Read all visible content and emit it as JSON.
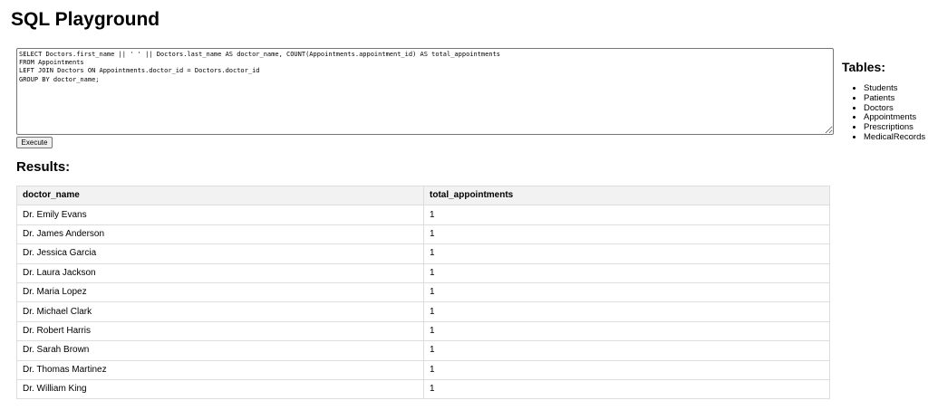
{
  "page": {
    "title": "SQL Playground"
  },
  "editor": {
    "query": "SELECT Doctors.first_name || ' ' || Doctors.last_name AS doctor_name, COUNT(Appointments.appointment_id) AS total_appointments\nFROM Appointments\nLEFT JOIN Doctors ON Appointments.doctor_id = Doctors.doctor_id\nGROUP BY doctor_name;"
  },
  "toolbar": {
    "execute_label": "Execute"
  },
  "results": {
    "heading": "Results:",
    "columns": [
      "doctor_name",
      "total_appointments"
    ],
    "rows": [
      [
        "Dr. Emily Evans",
        "1"
      ],
      [
        "Dr. James Anderson",
        "1"
      ],
      [
        "Dr. Jessica Garcia",
        "1"
      ],
      [
        "Dr. Laura Jackson",
        "1"
      ],
      [
        "Dr. Maria Lopez",
        "1"
      ],
      [
        "Dr. Michael Clark",
        "1"
      ],
      [
        "Dr. Robert Harris",
        "1"
      ],
      [
        "Dr. Sarah Brown",
        "1"
      ],
      [
        "Dr. Thomas Martinez",
        "1"
      ],
      [
        "Dr. William King",
        "1"
      ]
    ]
  },
  "tables": {
    "heading": "Tables:",
    "items": [
      "Students",
      "Patients",
      "Doctors",
      "Appointments",
      "Prescriptions",
      "MedicalRecords"
    ]
  }
}
